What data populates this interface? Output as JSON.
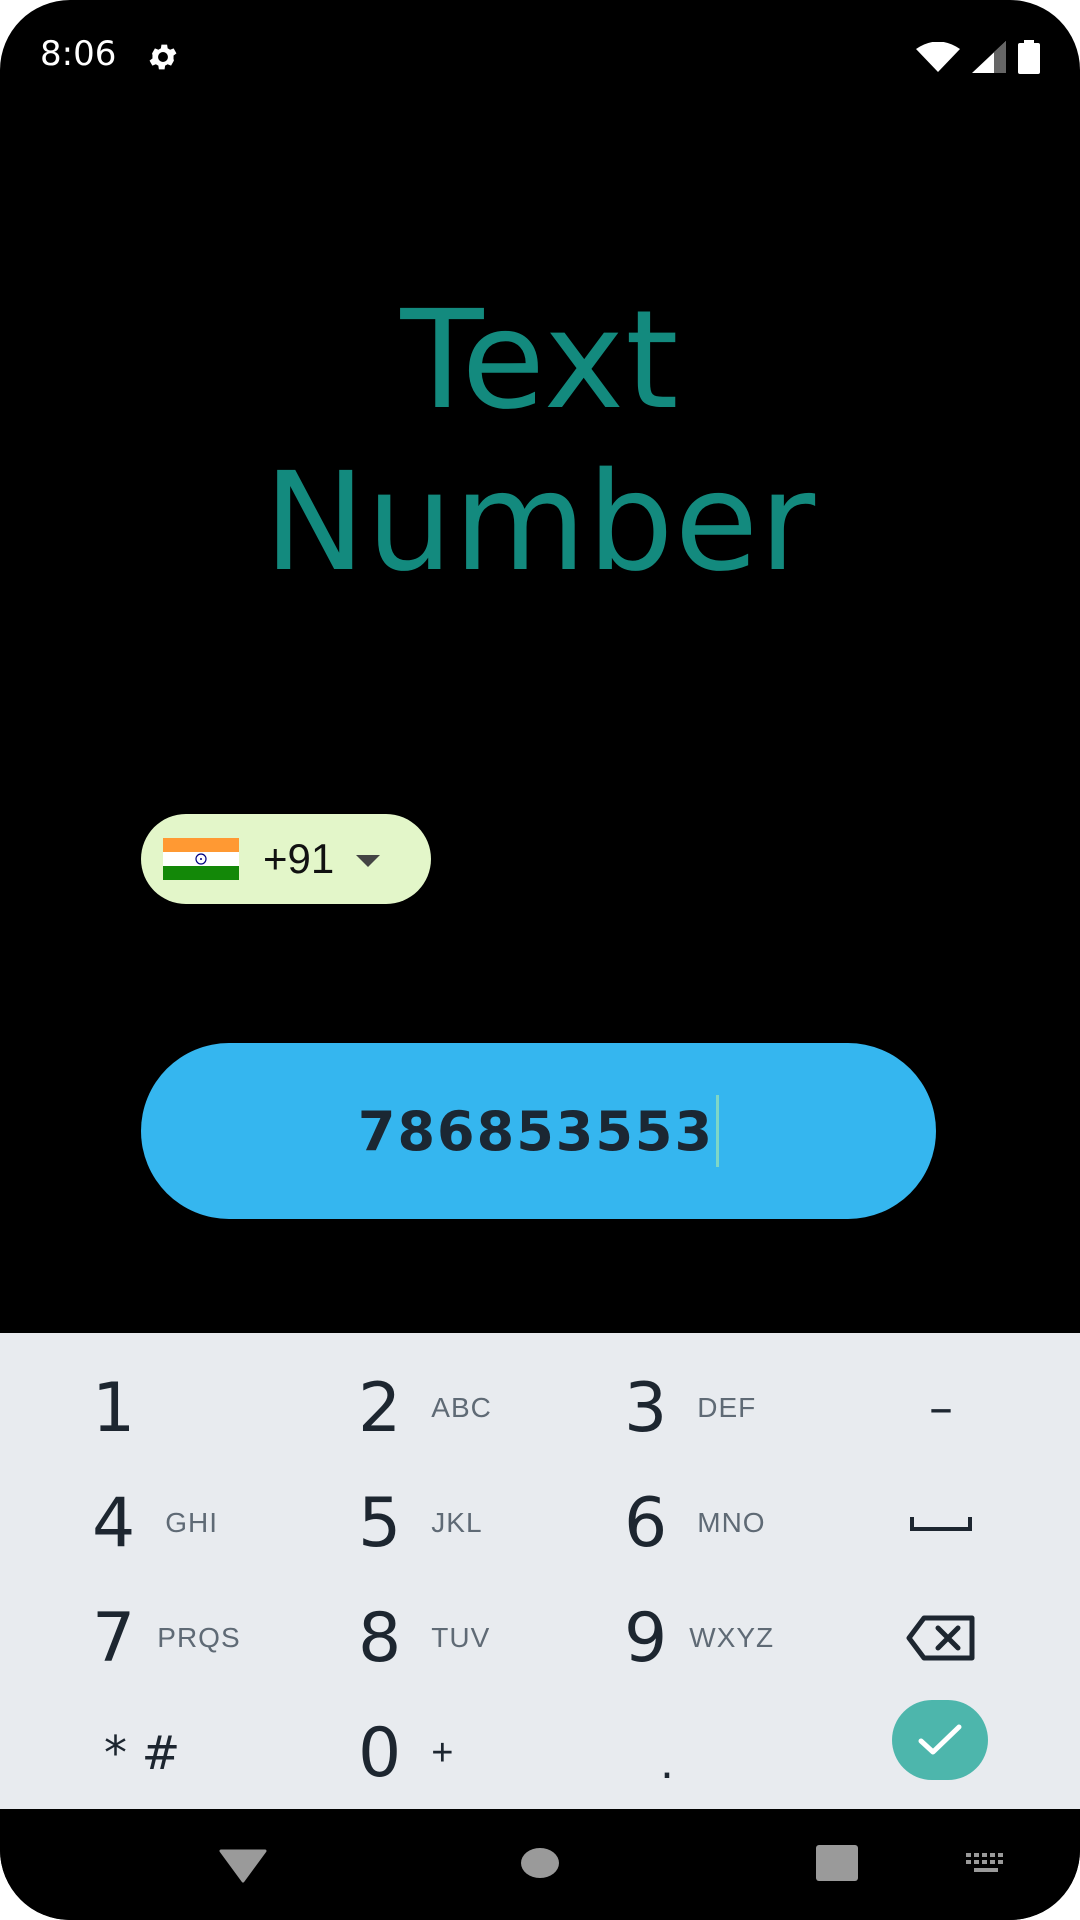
{
  "status_bar": {
    "time": "8:06",
    "icons": [
      "settings-icon",
      "wifi-icon",
      "cell-signal-icon",
      "battery-icon"
    ]
  },
  "title": {
    "line1": "Text",
    "line2": "Number",
    "color": "#138a7e"
  },
  "country_picker": {
    "flag": "india-flag",
    "dial_code": "+91",
    "background": "#e3f6c9"
  },
  "phone_input": {
    "value": "786853553",
    "background": "#35b6ef"
  },
  "keypad": {
    "keys": [
      {
        "digit": "1",
        "letters": ""
      },
      {
        "digit": "2",
        "letters": "ABC"
      },
      {
        "digit": "3",
        "letters": "DEF"
      },
      {
        "digit": "4",
        "letters": "GHI"
      },
      {
        "digit": "5",
        "letters": "JKL"
      },
      {
        "digit": "6",
        "letters": "MNO"
      },
      {
        "digit": "7",
        "letters": "PRQS"
      },
      {
        "digit": "8",
        "letters": "TUV"
      },
      {
        "digit": "9",
        "letters": "WXYZ"
      },
      {
        "digit": "* #",
        "letters": ""
      },
      {
        "digit": "0",
        "letters": "+"
      },
      {
        "digit": ".",
        "letters": ""
      }
    ],
    "function_keys": {
      "dash": "–"
    },
    "done_color": "#4db6ac"
  },
  "nav_bar": {
    "icons": [
      "back-icon",
      "home-icon",
      "recents-icon",
      "keyboard-switch-icon"
    ]
  }
}
